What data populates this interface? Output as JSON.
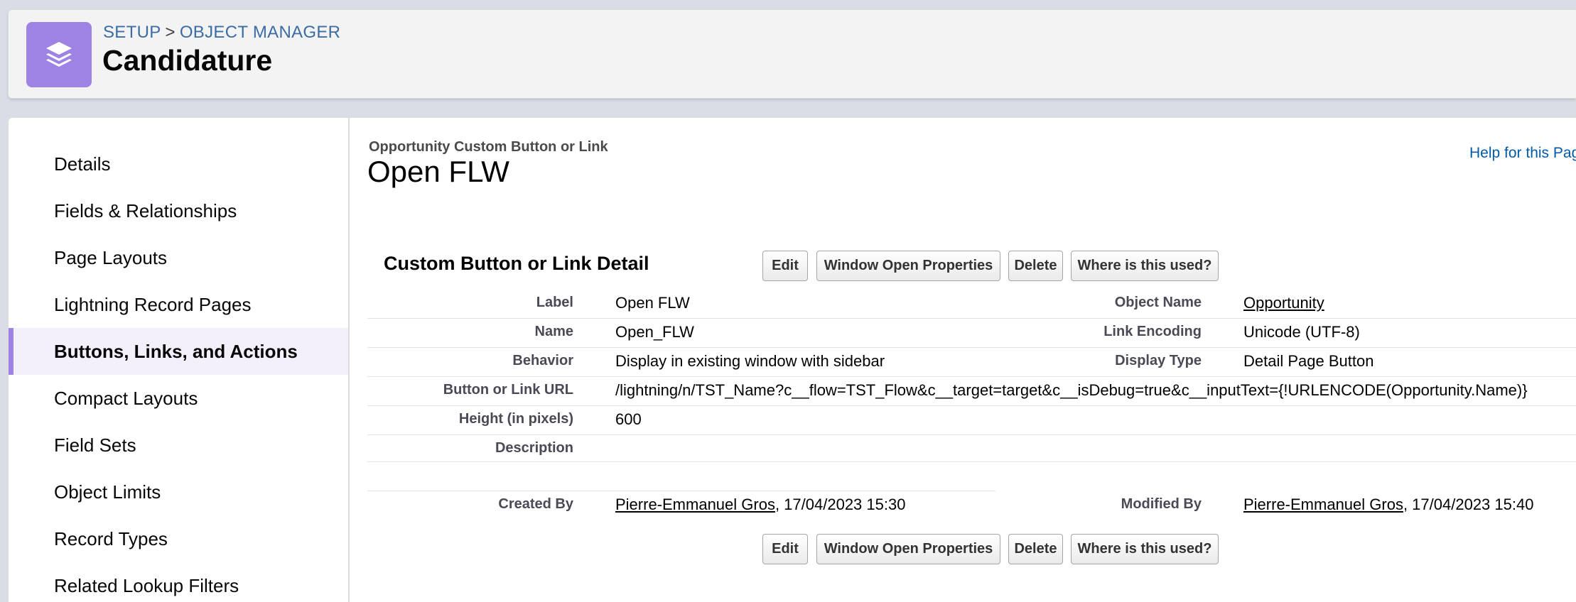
{
  "header": {
    "breadcrumb": {
      "setup": "SETUP",
      "separator": ">",
      "object_manager": "OBJECT MANAGER"
    },
    "title": "Candidature",
    "icon": "layers-icon",
    "icon_color": "#9e83e4"
  },
  "sidebar": {
    "items": [
      {
        "label": "Details"
      },
      {
        "label": "Fields & Relationships"
      },
      {
        "label": "Page Layouts"
      },
      {
        "label": "Lightning Record Pages"
      },
      {
        "label": "Buttons, Links, and Actions",
        "active": true
      },
      {
        "label": "Compact Layouts"
      },
      {
        "label": "Field Sets"
      },
      {
        "label": "Object Limits"
      },
      {
        "label": "Record Types"
      },
      {
        "label": "Related Lookup Filters"
      }
    ]
  },
  "detail": {
    "subtitle": "Opportunity Custom Button or Link",
    "title": "Open FLW",
    "help_link": "Help for this Pag",
    "section_title": "Custom Button or Link Detail",
    "buttons": {
      "edit": "Edit",
      "window_open_properties": "Window Open Properties",
      "delete": "Delete",
      "where_used": "Where is this used?"
    },
    "fields": {
      "label": {
        "label": "Label",
        "value": "Open FLW"
      },
      "name": {
        "label": "Name",
        "value": "Open_FLW"
      },
      "behavior": {
        "label": "Behavior",
        "value": "Display in existing window with sidebar"
      },
      "url": {
        "label": "Button or Link URL",
        "value": "/lightning/n/TST_Name?c__flow=TST_Flow&c__target=target&c__isDebug=true&c__inputText={!URLENCODE(Opportunity.Name)}"
      },
      "height": {
        "label": "Height (in pixels)",
        "value": "600"
      },
      "description": {
        "label": "Description",
        "value": ""
      },
      "object_name": {
        "label": "Object Name",
        "value": "Opportunity"
      },
      "link_encoding": {
        "label": "Link Encoding",
        "value": "Unicode (UTF-8)"
      },
      "display_type": {
        "label": "Display Type",
        "value": "Detail Page Button"
      }
    },
    "created": {
      "label": "Created By",
      "user": "Pierre-Emmanuel Gros",
      "date": ", 17/04/2023 15:30"
    },
    "modified": {
      "label": "Modified By",
      "user": "Pierre-Emmanuel Gros",
      "date": ", 17/04/2023 15:40"
    }
  }
}
